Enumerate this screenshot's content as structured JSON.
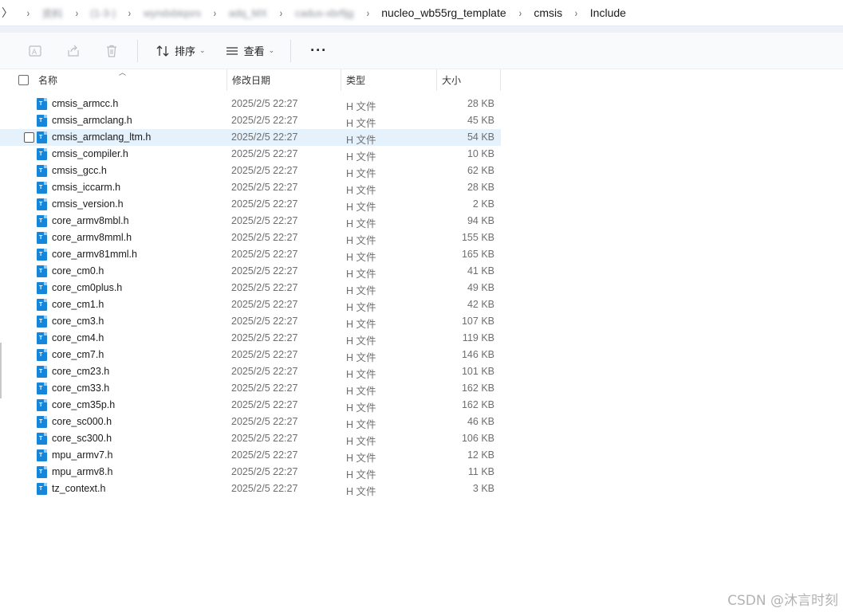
{
  "breadcrumb": {
    "items": [
      {
        "label": "资料",
        "blurred": true
      },
      {
        "label": "(1-3-)",
        "blurred": true
      },
      {
        "label": "wyndxbtqsrs",
        "blurred": true
      },
      {
        "label": "adq_MX",
        "blurred": true
      },
      {
        "label": "cadus-xbrfijg",
        "blurred": true
      },
      {
        "label": "nucleo_wb55rg_template",
        "blurred": false
      },
      {
        "label": "cmsis",
        "blurred": false
      },
      {
        "label": "Include",
        "blurred": false
      }
    ],
    "separator": "›"
  },
  "toolbar": {
    "sort_label": "排序",
    "view_label": "查看",
    "more_label": "···"
  },
  "columns": {
    "name": "名称",
    "modified": "修改日期",
    "type": "类型",
    "size": "大小"
  },
  "files": [
    {
      "name": "cmsis_armcc.h",
      "modified": "2025/2/5 22:27",
      "type": "H 文件",
      "size": "28 KB"
    },
    {
      "name": "cmsis_armclang.h",
      "modified": "2025/2/5 22:27",
      "type": "H 文件",
      "size": "45 KB"
    },
    {
      "name": "cmsis_armclang_ltm.h",
      "modified": "2025/2/5 22:27",
      "type": "H 文件",
      "size": "54 KB",
      "selected": true
    },
    {
      "name": "cmsis_compiler.h",
      "modified": "2025/2/5 22:27",
      "type": "H 文件",
      "size": "10 KB"
    },
    {
      "name": "cmsis_gcc.h",
      "modified": "2025/2/5 22:27",
      "type": "H 文件",
      "size": "62 KB"
    },
    {
      "name": "cmsis_iccarm.h",
      "modified": "2025/2/5 22:27",
      "type": "H 文件",
      "size": "28 KB"
    },
    {
      "name": "cmsis_version.h",
      "modified": "2025/2/5 22:27",
      "type": "H 文件",
      "size": "2 KB"
    },
    {
      "name": "core_armv8mbl.h",
      "modified": "2025/2/5 22:27",
      "type": "H 文件",
      "size": "94 KB"
    },
    {
      "name": "core_armv8mml.h",
      "modified": "2025/2/5 22:27",
      "type": "H 文件",
      "size": "155 KB"
    },
    {
      "name": "core_armv81mml.h",
      "modified": "2025/2/5 22:27",
      "type": "H 文件",
      "size": "165 KB"
    },
    {
      "name": "core_cm0.h",
      "modified": "2025/2/5 22:27",
      "type": "H 文件",
      "size": "41 KB"
    },
    {
      "name": "core_cm0plus.h",
      "modified": "2025/2/5 22:27",
      "type": "H 文件",
      "size": "49 KB"
    },
    {
      "name": "core_cm1.h",
      "modified": "2025/2/5 22:27",
      "type": "H 文件",
      "size": "42 KB"
    },
    {
      "name": "core_cm3.h",
      "modified": "2025/2/5 22:27",
      "type": "H 文件",
      "size": "107 KB"
    },
    {
      "name": "core_cm4.h",
      "modified": "2025/2/5 22:27",
      "type": "H 文件",
      "size": "119 KB"
    },
    {
      "name": "core_cm7.h",
      "modified": "2025/2/5 22:27",
      "type": "H 文件",
      "size": "146 KB"
    },
    {
      "name": "core_cm23.h",
      "modified": "2025/2/5 22:27",
      "type": "H 文件",
      "size": "101 KB"
    },
    {
      "name": "core_cm33.h",
      "modified": "2025/2/5 22:27",
      "type": "H 文件",
      "size": "162 KB"
    },
    {
      "name": "core_cm35p.h",
      "modified": "2025/2/5 22:27",
      "type": "H 文件",
      "size": "162 KB"
    },
    {
      "name": "core_sc000.h",
      "modified": "2025/2/5 22:27",
      "type": "H 文件",
      "size": "46 KB"
    },
    {
      "name": "core_sc300.h",
      "modified": "2025/2/5 22:27",
      "type": "H 文件",
      "size": "106 KB"
    },
    {
      "name": "mpu_armv7.h",
      "modified": "2025/2/5 22:27",
      "type": "H 文件",
      "size": "12 KB"
    },
    {
      "name": "mpu_armv8.h",
      "modified": "2025/2/5 22:27",
      "type": "H 文件",
      "size": "11 KB"
    },
    {
      "name": "tz_context.h",
      "modified": "2025/2/5 22:27",
      "type": "H 文件",
      "size": "3 KB"
    }
  ],
  "watermark": "CSDN @沐言时刻",
  "icons": {
    "rename": "rename-icon",
    "share": "share-icon",
    "delete": "trash-icon",
    "sort": "sort-icon",
    "view": "view-list-icon",
    "file": "file-h-icon"
  },
  "colors": {
    "accent": "#1886d8",
    "selected_row": "#e5f1fb"
  }
}
